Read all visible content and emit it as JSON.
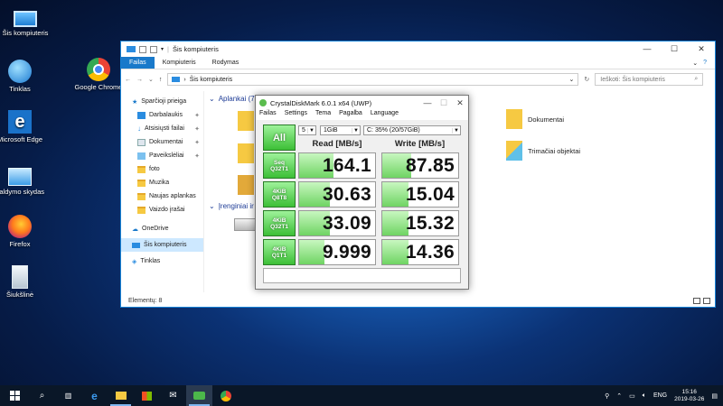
{
  "desktop": {
    "icons": [
      {
        "label": "Šis kompiuteris"
      },
      {
        "label": "Tinklas"
      },
      {
        "label": "Microsoft Edge"
      },
      {
        "label": "Valdymo skydas"
      },
      {
        "label": "Firefox"
      },
      {
        "label": "Šiukšlinė"
      },
      {
        "label": "Google Chrome"
      }
    ]
  },
  "explorer": {
    "title": "Šis kompiuteris",
    "tabs": [
      "Failas",
      "Kompiuteris",
      "Rodymas"
    ],
    "address": "Šis kompiuteris",
    "search_placeholder": "Ieškoti: Šis kompiuteris",
    "nav": {
      "quick_access": "Sparčioji prieiga",
      "items": [
        "Darbalaukis",
        "Atsisiųsti failai",
        "Dokumentai",
        "Paveikslėliai",
        "foto",
        "Muzika",
        "Naujas aplankas",
        "Vaizdo įrašai"
      ],
      "onedrive": "OneDrive",
      "this_pc": "Šis kompiuteris",
      "network": "Tinklas"
    },
    "sections": {
      "folders": "Aplankai (7)",
      "devices": "Įrenginiai ir"
    },
    "folders": [
      "Dokumentai",
      "Trimačiai objektai"
    ],
    "status": "Elementų: 8"
  },
  "cdm": {
    "title": "CrystalDiskMark 6.0.1 x64 (UWP)",
    "menu": [
      "Failas",
      "Settings",
      "Tema",
      "Pagalba",
      "Language"
    ],
    "all_label": "All",
    "count": "5",
    "size": "1GiB",
    "drive": "C: 35% (20/57GiB)",
    "read_header": "Read [MB/s]",
    "write_header": "Write [MB/s]",
    "rows": [
      {
        "line1": "Seq",
        "line2": "Q32T1",
        "read": "164.1",
        "write": "87.85",
        "read_fill": 0.45,
        "write_fill": 0.38
      },
      {
        "line1": "4KiB",
        "line2": "Q8T8",
        "read": "30.63",
        "write": "15.04",
        "read_fill": 0.4,
        "write_fill": 0.35
      },
      {
        "line1": "4KiB",
        "line2": "Q32T1",
        "read": "33.09",
        "write": "15.32",
        "read_fill": 0.4,
        "write_fill": 0.35
      },
      {
        "line1": "4KiB",
        "line2": "Q1T1",
        "read": "9.999",
        "write": "14.36",
        "read_fill": 0.33,
        "write_fill": 0.35
      }
    ]
  },
  "taskbar": {
    "lang": "ENG",
    "time": "15:16",
    "date": "2019-03-26"
  }
}
